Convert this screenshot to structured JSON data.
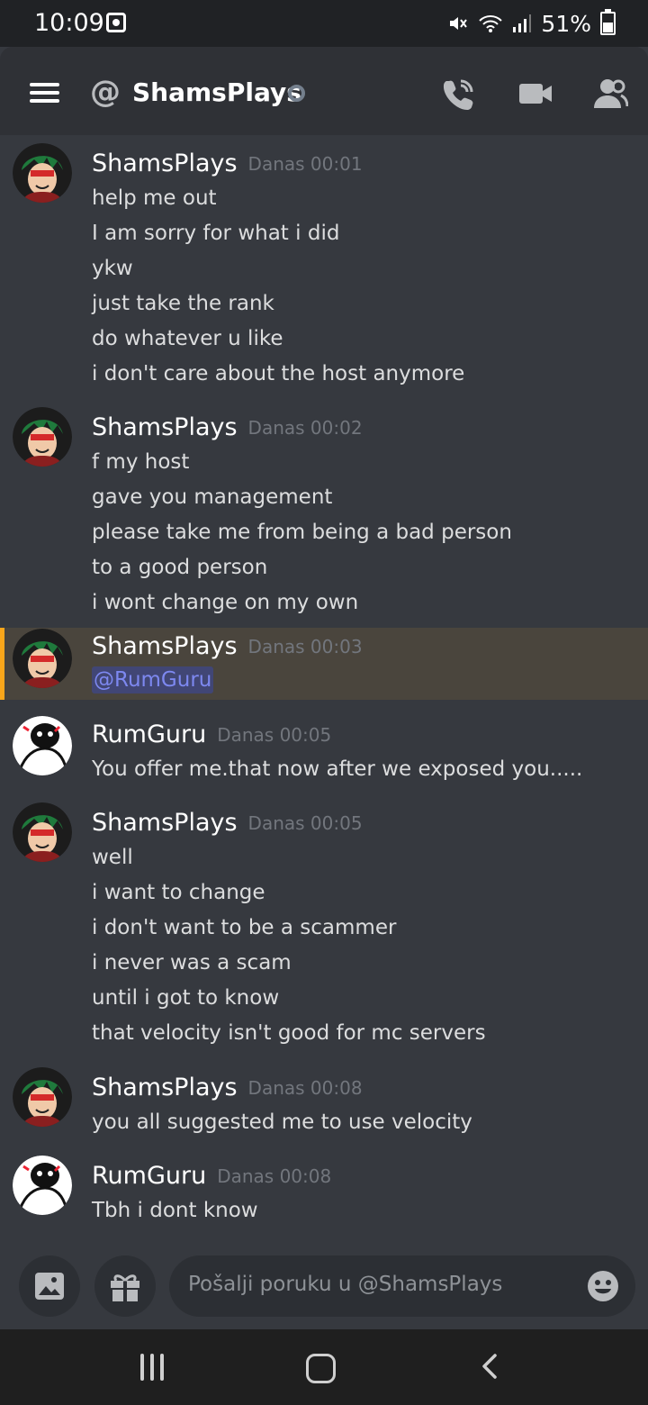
{
  "status_bar": {
    "time": "10:09",
    "battery": "51%"
  },
  "header": {
    "at_symbol": "@",
    "channel_name": "ShamsPlays"
  },
  "messages": [
    {
      "author": "ShamsPlays",
      "timestamp": "Danas 00:01",
      "lines": [
        "help me out",
        "I am sorry for what i did",
        "ykw",
        "just take the rank",
        "do whatever u like",
        "i don't care about the host anymore"
      ]
    },
    {
      "author": "ShamsPlays",
      "timestamp": "Danas 00:02",
      "lines": [
        "f my host",
        "gave you management",
        "please take me from being a bad person",
        "to a good person",
        "i wont change on my own"
      ]
    },
    {
      "author": "ShamsPlays",
      "timestamp": "Danas 00:03",
      "mention": "@RumGuru"
    },
    {
      "author": "RumGuru",
      "timestamp": "Danas 00:05",
      "lines": [
        "You offer me.that now after we exposed you....."
      ]
    },
    {
      "author": "ShamsPlays",
      "timestamp": "Danas 00:05",
      "lines": [
        "well",
        "i want to change",
        "i don't want to be a scammer",
        "i never was a scam",
        "until i got to know",
        "that velocity isn't good for mc servers"
      ]
    },
    {
      "author": "ShamsPlays",
      "timestamp": "Danas 00:08",
      "lines": [
        "you all suggested me to use velocity"
      ]
    },
    {
      "author": "RumGuru",
      "timestamp": "Danas 00:08",
      "lines": [
        "Tbh i dont know"
      ]
    }
  ],
  "composer": {
    "placeholder": "Pošalji poruku u @ShamsPlays"
  },
  "colors": {
    "background": "#36393f",
    "header": "#2f3136",
    "mention_text": "#7d88f0",
    "highlight_bar": "#faa61a"
  }
}
